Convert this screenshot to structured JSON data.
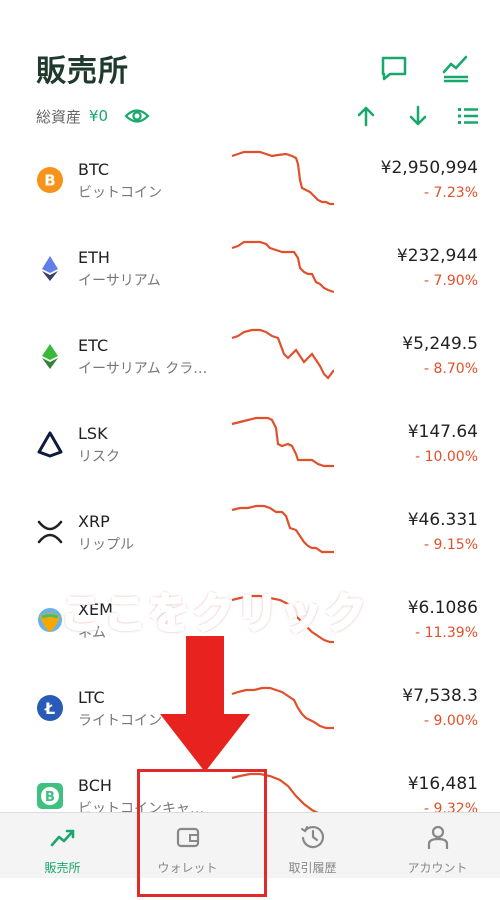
{
  "header": {
    "title": "販売所",
    "assets_label": "総資産",
    "assets_value": "¥0"
  },
  "icons": {
    "chat": "chat-bubble-icon",
    "chart": "line-chart-icon",
    "eye": "eye-icon",
    "sort_up": "arrow-up-icon",
    "sort_down": "arrow-down-icon",
    "list": "list-icon"
  },
  "colors": {
    "accent": "#17a86b",
    "negative": "#e0502b",
    "annotation": "#e12a2a"
  },
  "coins": [
    {
      "symbol": "BTC",
      "name": "ビットコイン",
      "price": "¥2,950,994",
      "change": "- 7.23%",
      "icon": "bitcoin-icon"
    },
    {
      "symbol": "ETH",
      "name": "イーサリアム",
      "price": "¥232,944",
      "change": "- 7.90%",
      "icon": "ethereum-icon"
    },
    {
      "symbol": "ETC",
      "name": "イーサリアム クラ…",
      "price": "¥5,249.5",
      "change": "- 8.70%",
      "icon": "ethereum-classic-icon"
    },
    {
      "symbol": "LSK",
      "name": "リスク",
      "price": "¥147.64",
      "change": "- 10.00%",
      "icon": "lisk-icon"
    },
    {
      "symbol": "XRP",
      "name": "リップル",
      "price": "¥46.331",
      "change": "- 9.15%",
      "icon": "xrp-icon"
    },
    {
      "symbol": "XEM",
      "name": "ネム",
      "price": "¥6.1086",
      "change": "- 11.39%",
      "icon": "nem-icon"
    },
    {
      "symbol": "LTC",
      "name": "ライトコイン",
      "price": "¥7,538.3",
      "change": "- 9.00%",
      "icon": "litecoin-icon"
    },
    {
      "symbol": "BCH",
      "name": "ビットコインキャ…",
      "price": "¥16,481",
      "change": "- 9.32%",
      "icon": "bitcoin-cash-icon"
    }
  ],
  "tabs": [
    {
      "label": "販売所",
      "icon": "trend-up-icon",
      "active": true
    },
    {
      "label": "ウォレット",
      "icon": "wallet-icon",
      "active": false
    },
    {
      "label": "取引履歴",
      "icon": "history-icon",
      "active": false
    },
    {
      "label": "アカウント",
      "icon": "person-icon",
      "active": false
    }
  ],
  "annotation": {
    "text": "ここをクリック"
  }
}
